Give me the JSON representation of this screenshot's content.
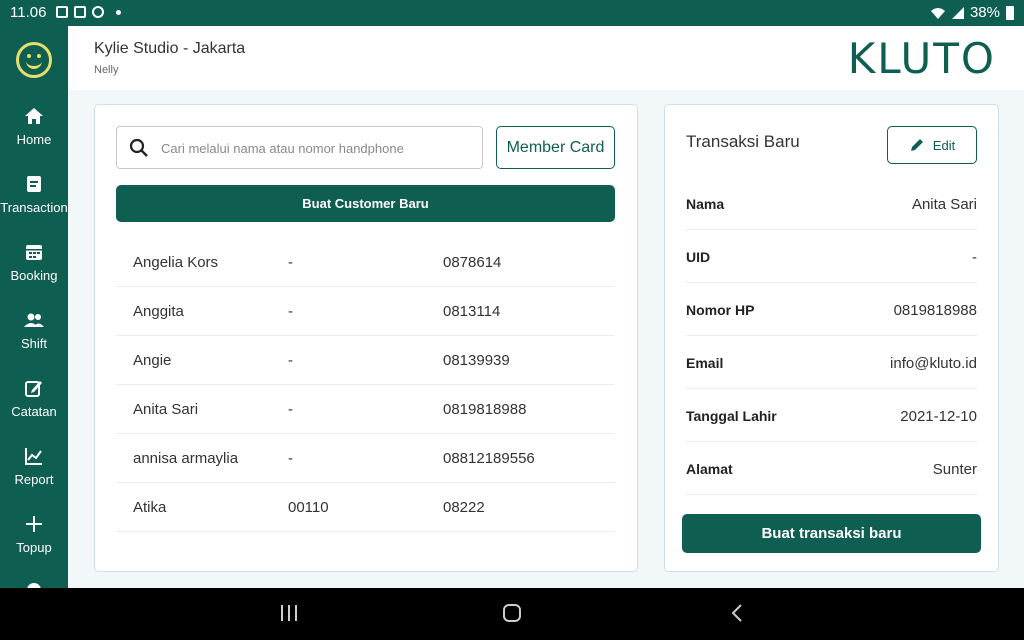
{
  "status_bar": {
    "time": "11.06",
    "battery": "38%"
  },
  "sidebar": {
    "items": [
      {
        "label": "Home",
        "icon": "home-icon"
      },
      {
        "label": "Transaction",
        "icon": "receipt-icon"
      },
      {
        "label": "Booking",
        "icon": "calendar-icon"
      },
      {
        "label": "Shift",
        "icon": "people-icon"
      },
      {
        "label": "Catatan",
        "icon": "edit-note-icon"
      },
      {
        "label": "Report",
        "icon": "chart-icon"
      },
      {
        "label": "Topup",
        "icon": "plus-icon"
      }
    ]
  },
  "header": {
    "store_name": "Kylie Studio - Jakarta",
    "user_name": "Nelly",
    "brand": "KLUTO"
  },
  "search": {
    "placeholder": "Cari melalui nama atau nomor handphone"
  },
  "buttons": {
    "member_card": "Member Card",
    "new_customer": "Buat Customer Baru",
    "edit": "Edit",
    "new_transaction": "Buat transaksi baru"
  },
  "customers": [
    {
      "name": "Angelia Kors",
      "uid": "-",
      "phone": "0878614"
    },
    {
      "name": "Anggita",
      "uid": "-",
      "phone": "0813114"
    },
    {
      "name": "Angie",
      "uid": "-",
      "phone": "08139939"
    },
    {
      "name": "Anita Sari",
      "uid": "-",
      "phone": "0819818988"
    },
    {
      "name": "annisa armaylia",
      "uid": "-",
      "phone": "08812189556"
    },
    {
      "name": "Atika",
      "uid": "00110",
      "phone": "08222"
    }
  ],
  "transaction": {
    "title": "Transaksi Baru",
    "fields": [
      {
        "label": "Nama",
        "value": "Anita Sari"
      },
      {
        "label": "UID",
        "value": "-"
      },
      {
        "label": "Nomor HP",
        "value": "0819818988"
      },
      {
        "label": "Email",
        "value": "info@kluto.id"
      },
      {
        "label": "Tanggal Lahir",
        "value": "2021-12-10"
      },
      {
        "label": "Alamat",
        "value": "Sunter"
      }
    ]
  },
  "colors": {
    "primary": "#0f5e52",
    "accent_logo": "#e7df6a",
    "background": "#f2f8f9"
  }
}
